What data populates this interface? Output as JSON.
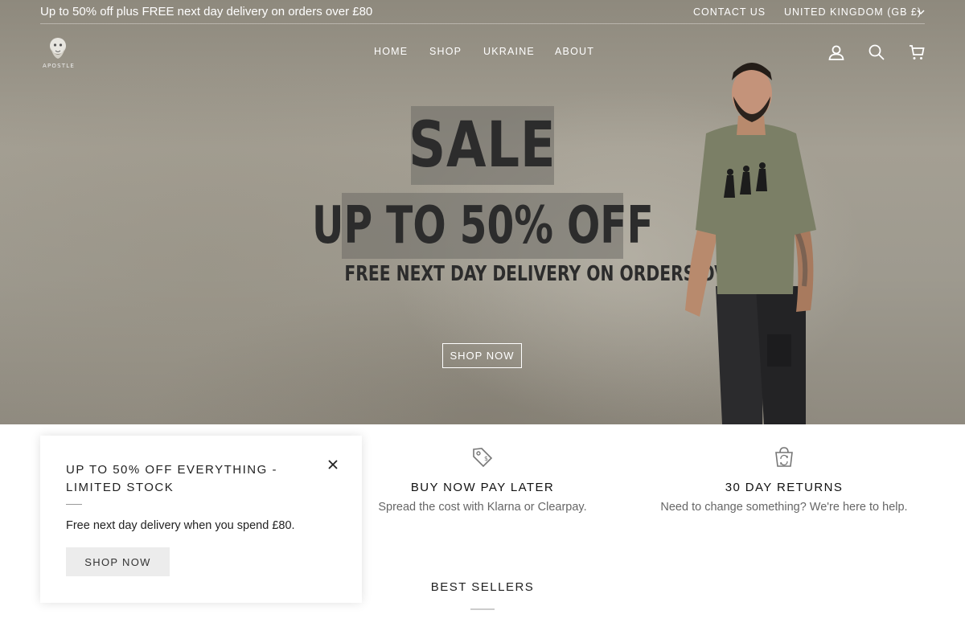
{
  "announcement": {
    "text": "Up to 50% off plus FREE next day delivery on orders over £80",
    "contact_label": "CONTACT US",
    "country_label": "UNITED KINGDOM (GB £)"
  },
  "header": {
    "logo_text": "APOSTLE",
    "nav": [
      {
        "label": "HOME"
      },
      {
        "label": "SHOP"
      },
      {
        "label": "UKRAINE"
      },
      {
        "label": "ABOUT"
      }
    ],
    "icons": [
      "account-icon",
      "search-icon",
      "cart-icon"
    ]
  },
  "hero": {
    "sale": "SALE",
    "discount": "UP TO 50% OFF",
    "delivery": "FREE NEXT DAY DELIVERY ON ORDERS OVER £80",
    "button_label": "SHOP NOW"
  },
  "features": [
    {
      "icon": "price-tag-icon",
      "title": "BUY NOW PAY LATER",
      "text": "Spread the cost with Klarna or Clearpay."
    },
    {
      "icon": "returns-bag-icon",
      "title": "30 DAY RETURNS",
      "text": "Need to change something? We're here to help."
    }
  ],
  "best_sellers": {
    "title": "BEST SELLERS"
  },
  "popup": {
    "title": "UP TO 50% OFF EVERYTHING - LIMITED STOCK",
    "text": "Free next day delivery when you spend £80.",
    "button_label": "SHOP NOW"
  },
  "colors": {
    "hero_background": "#9e9a8f",
    "popup_button": "#ececec",
    "text_dark": "#222222",
    "text_muted": "#666666"
  }
}
